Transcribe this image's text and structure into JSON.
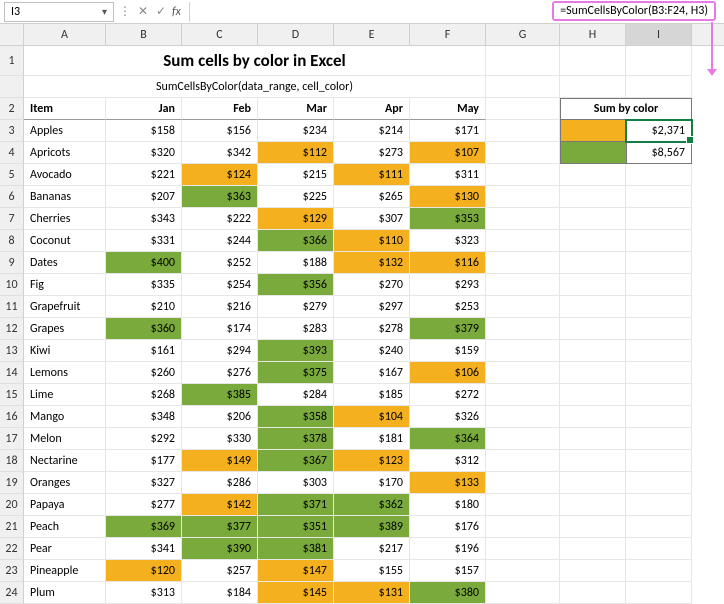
{
  "activeCellRef": "I3",
  "formula": "=SumCellsByColor(B3:F24, H3)",
  "title": "Sum cells by color in Excel",
  "subtitle": "SumCellsByColor(data_range, cell_color)",
  "columns": [
    "",
    "A",
    "B",
    "C",
    "D",
    "E",
    "F",
    "G",
    "H",
    "I"
  ],
  "headers": {
    "item": "Item",
    "jan": "Jan",
    "feb": "Feb",
    "mar": "Mar",
    "apr": "Apr",
    "may": "May"
  },
  "sumHeader": "Sum by color",
  "sums": {
    "orange": "$2,371",
    "green": "$8,567"
  },
  "rows": [
    {
      "n": 3,
      "item": "Apples",
      "v": [
        "$158",
        "$156",
        "$234",
        "$214",
        "$171"
      ],
      "c": [
        "",
        "",
        "",
        "",
        ""
      ]
    },
    {
      "n": 4,
      "item": "Apricots",
      "v": [
        "$320",
        "$342",
        "$112",
        "$273",
        "$107"
      ],
      "c": [
        "",
        "",
        "orange",
        "",
        "orange"
      ]
    },
    {
      "n": 5,
      "item": "Avocado",
      "v": [
        "$221",
        "$124",
        "$215",
        "$111",
        "$311"
      ],
      "c": [
        "",
        "orange",
        "",
        "orange",
        ""
      ]
    },
    {
      "n": 6,
      "item": "Bananas",
      "v": [
        "$207",
        "$363",
        "$225",
        "$265",
        "$130"
      ],
      "c": [
        "",
        "green",
        "",
        "",
        "orange"
      ]
    },
    {
      "n": 7,
      "item": "Cherries",
      "v": [
        "$343",
        "$222",
        "$129",
        "$307",
        "$353"
      ],
      "c": [
        "",
        "",
        "orange",
        "",
        "green"
      ]
    },
    {
      "n": 8,
      "item": "Coconut",
      "v": [
        "$331",
        "$244",
        "$366",
        "$110",
        "$323"
      ],
      "c": [
        "",
        "",
        "green",
        "orange",
        ""
      ]
    },
    {
      "n": 9,
      "item": "Dates",
      "v": [
        "$400",
        "$252",
        "$188",
        "$132",
        "$116"
      ],
      "c": [
        "green",
        "",
        "",
        "orange",
        "orange"
      ]
    },
    {
      "n": 10,
      "item": "Fig",
      "v": [
        "$335",
        "$254",
        "$356",
        "$270",
        "$293"
      ],
      "c": [
        "",
        "",
        "green",
        "",
        ""
      ]
    },
    {
      "n": 11,
      "item": "Grapefruit",
      "v": [
        "$210",
        "$216",
        "$279",
        "$297",
        "$253"
      ],
      "c": [
        "",
        "",
        "",
        "",
        ""
      ]
    },
    {
      "n": 12,
      "item": "Grapes",
      "v": [
        "$360",
        "$174",
        "$283",
        "$278",
        "$379"
      ],
      "c": [
        "green",
        "",
        "",
        "",
        "green"
      ]
    },
    {
      "n": 13,
      "item": "Kiwi",
      "v": [
        "$161",
        "$294",
        "$393",
        "$240",
        "$159"
      ],
      "c": [
        "",
        "",
        "green",
        "",
        ""
      ]
    },
    {
      "n": 14,
      "item": "Lemons",
      "v": [
        "$260",
        "$276",
        "$375",
        "$167",
        "$106"
      ],
      "c": [
        "",
        "",
        "green",
        "",
        "orange"
      ]
    },
    {
      "n": 15,
      "item": "Lime",
      "v": [
        "$268",
        "$385",
        "$284",
        "$185",
        "$272"
      ],
      "c": [
        "",
        "green",
        "",
        "",
        ""
      ]
    },
    {
      "n": 16,
      "item": "Mango",
      "v": [
        "$348",
        "$206",
        "$358",
        "$104",
        "$326"
      ],
      "c": [
        "",
        "",
        "green",
        "orange",
        ""
      ]
    },
    {
      "n": 17,
      "item": "Melon",
      "v": [
        "$292",
        "$330",
        "$378",
        "$181",
        "$364"
      ],
      "c": [
        "",
        "",
        "green",
        "",
        "green"
      ]
    },
    {
      "n": 18,
      "item": "Nectarine",
      "v": [
        "$177",
        "$149",
        "$367",
        "$123",
        "$312"
      ],
      "c": [
        "",
        "orange",
        "green",
        "orange",
        ""
      ]
    },
    {
      "n": 19,
      "item": "Oranges",
      "v": [
        "$327",
        "$286",
        "$303",
        "$170",
        "$133"
      ],
      "c": [
        "",
        "",
        "",
        "",
        "orange"
      ]
    },
    {
      "n": 20,
      "item": "Papaya",
      "v": [
        "$277",
        "$142",
        "$371",
        "$362",
        "$180"
      ],
      "c": [
        "",
        "orange",
        "green",
        "green",
        ""
      ]
    },
    {
      "n": 21,
      "item": "Peach",
      "v": [
        "$369",
        "$377",
        "$351",
        "$389",
        "$176"
      ],
      "c": [
        "green",
        "green",
        "green",
        "green",
        ""
      ]
    },
    {
      "n": 22,
      "item": "Pear",
      "v": [
        "$341",
        "$390",
        "$381",
        "$217",
        "$196"
      ],
      "c": [
        "",
        "green",
        "green",
        "",
        ""
      ]
    },
    {
      "n": 23,
      "item": "Pineapple",
      "v": [
        "$120",
        "$257",
        "$147",
        "$155",
        "$157"
      ],
      "c": [
        "orange",
        "",
        "orange",
        "",
        ""
      ]
    },
    {
      "n": 24,
      "item": "Plum",
      "v": [
        "$313",
        "$184",
        "$145",
        "$131",
        "$380"
      ],
      "c": [
        "",
        "",
        "orange",
        "orange",
        "green"
      ]
    }
  ]
}
